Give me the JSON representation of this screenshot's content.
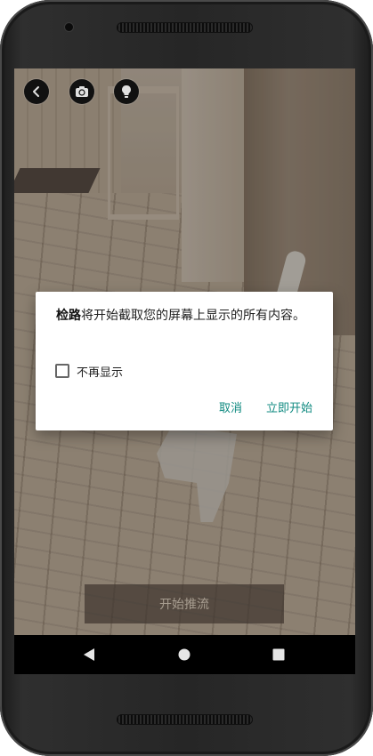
{
  "camera_toolbar": {
    "back_icon": "chevron-left-icon",
    "switch_camera_icon": "camera-switch-icon",
    "flash_icon": "lightbulb-icon"
  },
  "main": {
    "start_stream_label": "开始推流"
  },
  "dialog": {
    "app_name": "检路",
    "message": "将开始截取您的屏幕上显示的所有内容。",
    "checkbox_label": "不再显示",
    "checkbox_checked": false,
    "cancel_label": "取消",
    "start_now_label": "立即开始",
    "accent_color": "#0f8a80"
  },
  "nav_bar": {
    "back_icon": "triangle-back-icon",
    "home_icon": "circle-home-icon",
    "recents_icon": "square-recents-icon"
  }
}
